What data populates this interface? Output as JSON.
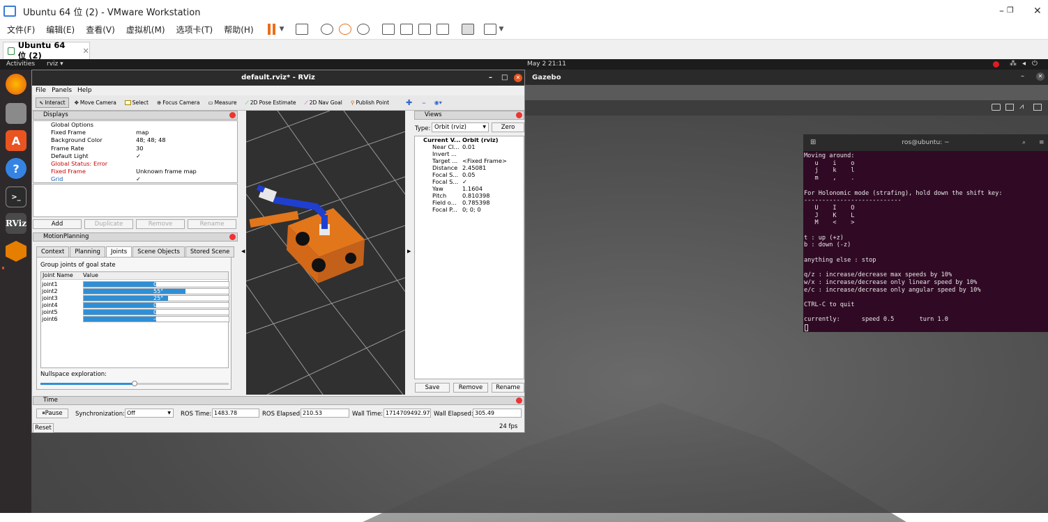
{
  "vmware": {
    "title": "Ubuntu 64 位 (2) - VMware Workstation",
    "menu": [
      "文件(F)",
      "编辑(E)",
      "查看(V)",
      "虚拟机(M)",
      "选项卡(T)",
      "帮助(H)"
    ],
    "tab_label": "Ubuntu 64 位 (2)",
    "tab_close": "✕",
    "win_min": "–",
    "win_max": "❐",
    "win_close": "✕"
  },
  "ubuntu": {
    "activities": "Activities",
    "app_menu": "rviz ▾",
    "clock": "May 2  21:11",
    "dock_rviz": "RViz"
  },
  "gazebo": {
    "title": "Gazebo"
  },
  "rviz": {
    "title": "default.rviz* - RViz",
    "menu": [
      "File",
      "Panels",
      "Help"
    ],
    "tools": [
      "Interact",
      "Move Camera",
      "Select",
      "Focus Camera",
      "Measure",
      "2D Pose Estimate",
      "2D Nav Goal",
      "Publish Point"
    ],
    "displays": {
      "header": "Displays",
      "rows": [
        {
          "k": "Global Options",
          "v": "",
          "indent": 0,
          "color": "#000"
        },
        {
          "k": "Fixed Frame",
          "v": "map",
          "indent": 1,
          "color": "#000"
        },
        {
          "k": "Background Color",
          "v": "48; 48; 48",
          "indent": 1,
          "color": "#000"
        },
        {
          "k": "Frame Rate",
          "v": "30",
          "indent": 1,
          "color": "#000"
        },
        {
          "k": "Default Light",
          "v": "✓",
          "indent": 1,
          "color": "#000"
        },
        {
          "k": "Global Status: Error",
          "v": "",
          "indent": 0,
          "color": "#c00"
        },
        {
          "k": "Fixed Frame",
          "v": "Unknown frame map",
          "indent": 1,
          "color": "#c00"
        },
        {
          "k": "Grid",
          "v": "✓",
          "indent": 0,
          "color": "#1a5fb4"
        }
      ],
      "buttons": [
        "Add",
        "Duplicate",
        "Remove",
        "Rename"
      ]
    },
    "motion": {
      "header": "MotionPlanning",
      "tabs": [
        "Context",
        "Planning",
        "Joints",
        "Scene Objects",
        "Stored Scene"
      ],
      "group_label": "Group joints of goal state",
      "col_name": "Joint Name",
      "col_value": "Value",
      "joints": [
        {
          "name": "joint1",
          "label": "0°",
          "fill": 0.5
        },
        {
          "name": "joint2",
          "label": "55°",
          "fill": 0.7
        },
        {
          "name": "joint3",
          "label": "25°",
          "fill": 0.58
        },
        {
          "name": "joint4",
          "label": "0°",
          "fill": 0.5
        },
        {
          "name": "joint5",
          "label": "0°",
          "fill": 0.5
        },
        {
          "name": "joint6",
          "label": "-0°",
          "fill": 0.5
        }
      ],
      "nullspace_label": "Nullspace exploration:",
      "nullspace_value": 0.5
    },
    "views": {
      "header": "Views",
      "type_label": "Type:",
      "type_value": "Orbit (rviz)",
      "zero": "Zero",
      "rows": [
        {
          "k": "Current V...",
          "v": "Orbit (rviz)",
          "bold": true
        },
        {
          "k": "Near Cl...",
          "v": "0.01"
        },
        {
          "k": "Invert ...",
          "v": ""
        },
        {
          "k": "Target ...",
          "v": "<Fixed Frame>"
        },
        {
          "k": "Distance",
          "v": "2.45081"
        },
        {
          "k": "Focal S...",
          "v": "0.05"
        },
        {
          "k": "Focal S...",
          "v": "✓"
        },
        {
          "k": "Yaw",
          "v": "1.1604"
        },
        {
          "k": "Pitch",
          "v": "0.810398"
        },
        {
          "k": "Field o...",
          "v": "0.785398"
        },
        {
          "k": "Focal P...",
          "v": "0; 0; 0"
        }
      ],
      "buttons": [
        "Save",
        "Remove",
        "Rename"
      ]
    },
    "time": {
      "header": "Time",
      "pause": "Pause",
      "sync_label": "Synchronization:",
      "sync_value": "Off",
      "ros_time_label": "ROS Time:",
      "ros_time": "1483.78",
      "ros_elapsed_label": "ROS Elapsed:",
      "ros_elapsed": "210.53",
      "wall_time_label": "Wall Time:",
      "wall_time": "1714709492.97",
      "wall_elapsed_label": "Wall Elapsed:",
      "wall_elapsed": "305.49",
      "reset": "Reset",
      "fps": "24 fps"
    }
  },
  "terminal": {
    "title": "ros@ubuntu: ~",
    "body": "Moving around:\n   u    i    o\n   j    k    l\n   m    ,    .\n\nFor Holonomic mode (strafing), hold down the shift key:\n---------------------------\n   U    I    O\n   J    K    L\n   M    <    >\n\nt : up (+z)\nb : down (-z)\n\nanything else : stop\n\nq/z : increase/decrease max speeds by 10%\nw/x : increase/decrease only linear speed by 10%\ne/c : increase/decrease only angular speed by 10%\n\nCTRL-C to quit\n\ncurrently:      speed 0.5       turn 1.0"
  },
  "colors": {
    "terminal_bg": "#300a24",
    "robot_orange": "#e2761b",
    "arm_blue": "#1f3fd1",
    "joint_bar": "#2f8fd6"
  }
}
